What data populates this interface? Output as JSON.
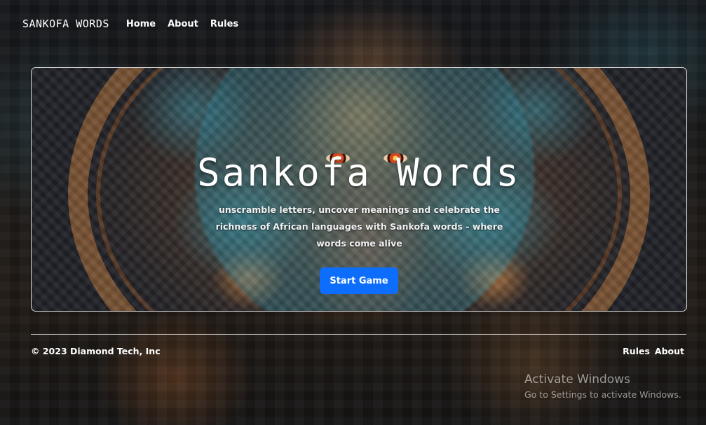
{
  "navbar": {
    "brand": "SANKOFA WORDS",
    "links": [
      "Home",
      "About",
      "Rules"
    ]
  },
  "hero": {
    "title": "Sankofa Words",
    "description": "unscramble letters, uncover meanings and celebrate the richness of African languages with Sankofa words - where words come alive",
    "cta_label": "Start Game"
  },
  "footer": {
    "copyright": "© 2023 Diamond Tech, Inc",
    "links": [
      "Rules",
      "About"
    ]
  },
  "watermark": {
    "title": "Activate Windows",
    "subtitle": "Go to Settings to activate Windows."
  },
  "colors": {
    "accent": "#0d6efd",
    "text": "#ffffff"
  }
}
